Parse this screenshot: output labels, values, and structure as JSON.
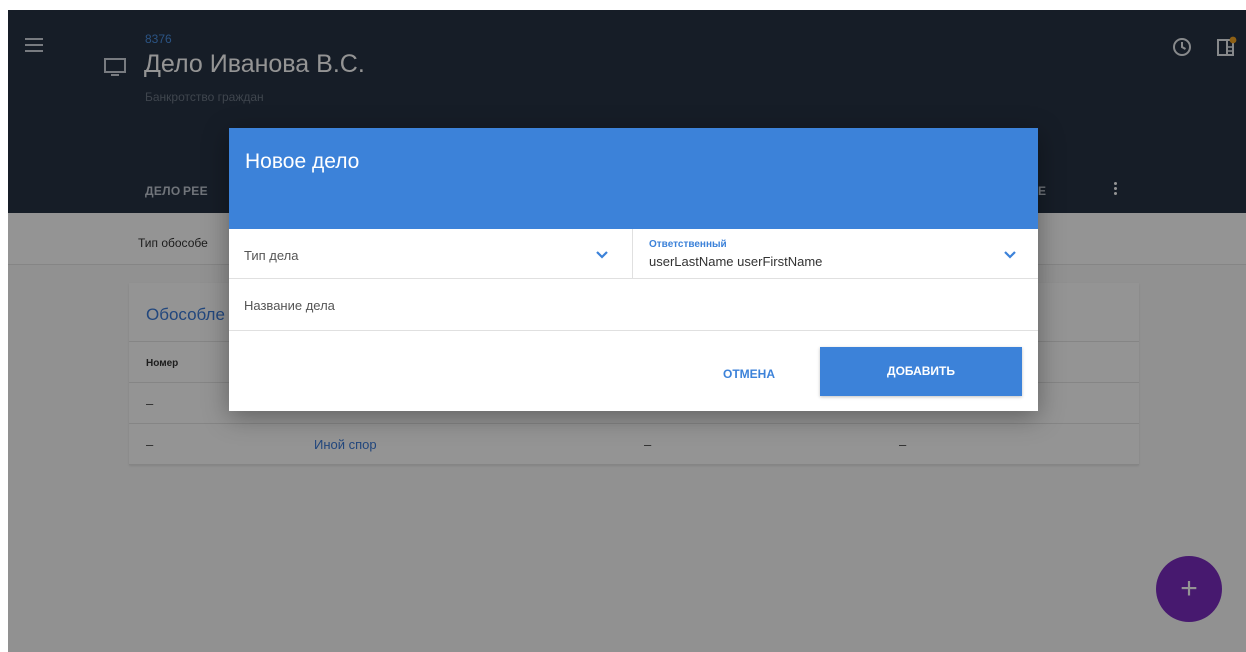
{
  "header": {
    "case_id": "8376",
    "case_title": "Дело Иванова В.С.",
    "case_subtitle": "Банкротство граждан",
    "tabs": [
      "ДЕЛО",
      "РЕЕ",
      "Е"
    ]
  },
  "filter_bar": {
    "label": "Тип обособе"
  },
  "card": {
    "title": "Обособле",
    "columns": [
      "Номер"
    ],
    "rows": [
      [
        "–",
        "",
        "",
        ""
      ],
      [
        "–",
        "Иной спор",
        "–",
        "–"
      ]
    ]
  },
  "fab": {
    "label": "+"
  },
  "dialog": {
    "title": "Новое дело",
    "type_placeholder": "Тип дела",
    "owner_label": "Ответственный",
    "owner_value": "userLastName userFirstName",
    "name_placeholder": "Название дела",
    "cancel_label": "ОТМЕНА",
    "add_label": "ДОБАВИТЬ"
  },
  "colors": {
    "header_bg": "#263244",
    "accent": "#3c82d9",
    "fab": "#7b2cbf",
    "notification_dot": "#f5a623"
  },
  "icons": [
    "menu-icon",
    "monitor-icon",
    "history-icon",
    "panel-icon",
    "more-vert-icon",
    "chevron-down-icon",
    "plus-icon"
  ]
}
